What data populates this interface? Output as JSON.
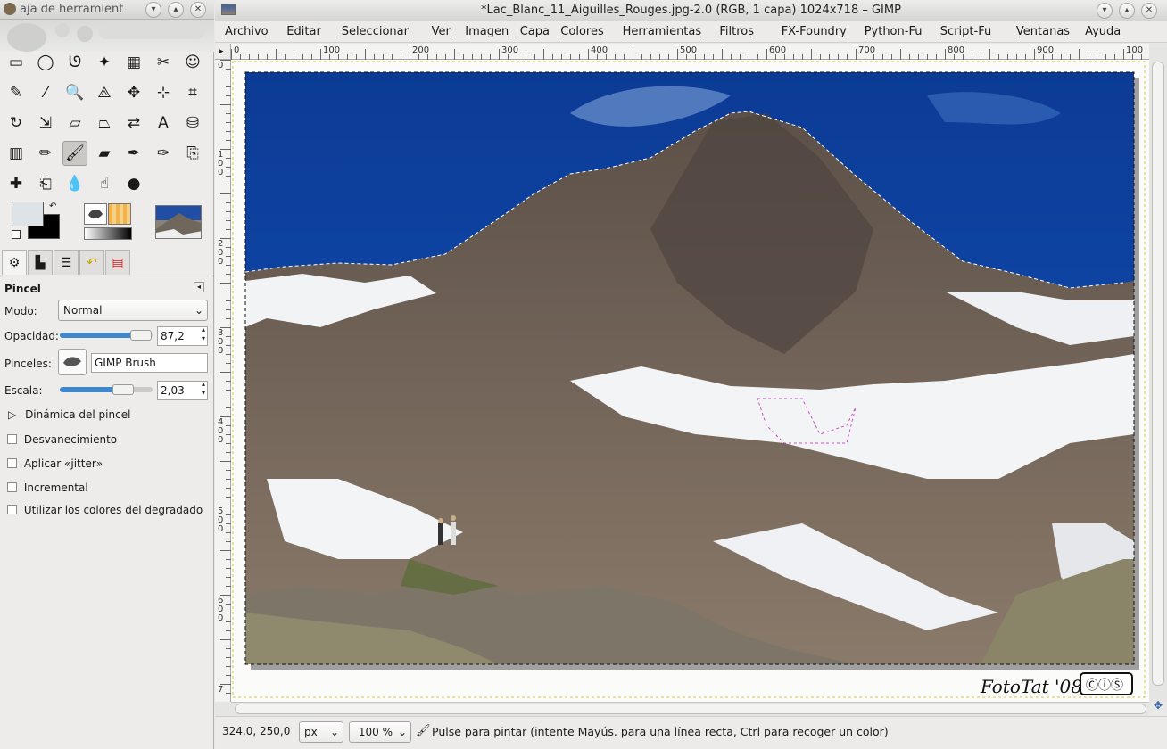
{
  "toolbox": {
    "title": "aja de herramient",
    "tools": [
      {
        "icon": "rect-select-icon",
        "glyph": "▭"
      },
      {
        "icon": "ellipse-select-icon",
        "glyph": "◯"
      },
      {
        "icon": "free-select-icon",
        "glyph": "ᘎ"
      },
      {
        "icon": "fuzzy-select-icon",
        "glyph": "✦"
      },
      {
        "icon": "color-select-icon",
        "glyph": "▦"
      },
      {
        "icon": "scissors-icon",
        "glyph": "✂"
      },
      {
        "icon": "foreground-select-icon",
        "glyph": "☺"
      },
      {
        "icon": "paths-icon",
        "glyph": "✎"
      },
      {
        "icon": "color-picker-icon",
        "glyph": "⁄"
      },
      {
        "icon": "zoom-icon",
        "glyph": "🔍"
      },
      {
        "icon": "measure-icon",
        "glyph": "⟁"
      },
      {
        "icon": "move-icon",
        "glyph": "✥"
      },
      {
        "icon": "align-icon",
        "glyph": "⊹"
      },
      {
        "icon": "crop-icon",
        "glyph": "⌗"
      },
      {
        "icon": "rotate-icon",
        "glyph": "↻"
      },
      {
        "icon": "scale-icon",
        "glyph": "⇲"
      },
      {
        "icon": "shear-icon",
        "glyph": "▱"
      },
      {
        "icon": "perspective-icon",
        "glyph": "⏢"
      },
      {
        "icon": "flip-icon",
        "glyph": "⇄"
      },
      {
        "icon": "text-icon",
        "glyph": "A"
      },
      {
        "icon": "bucket-fill-icon",
        "glyph": "⛁"
      },
      {
        "icon": "blend-icon",
        "glyph": "▥"
      },
      {
        "icon": "pencil-icon",
        "glyph": "✏"
      },
      {
        "icon": "paintbrush-icon",
        "glyph": "🖌"
      },
      {
        "icon": "eraser-icon",
        "glyph": "▰"
      },
      {
        "icon": "airbrush-icon",
        "glyph": "✒"
      },
      {
        "icon": "ink-icon",
        "glyph": "✑"
      },
      {
        "icon": "clone-icon",
        "glyph": "⎘"
      },
      {
        "icon": "heal-icon",
        "glyph": "✚"
      },
      {
        "icon": "perspective-clone-icon",
        "glyph": "⎗"
      },
      {
        "icon": "blur-icon",
        "glyph": "💧"
      },
      {
        "icon": "smudge-icon",
        "glyph": "☝"
      },
      {
        "icon": "dodge-burn-icon",
        "glyph": "●"
      }
    ],
    "fg_color": "#dde3e6",
    "bg_color": "#000000",
    "tabs": [
      "tool-options-tab",
      "device-status-tab",
      "layers-tab",
      "undo-history-tab",
      "palettes-tab"
    ],
    "options": {
      "title": "Pincel",
      "mode_label": "Modo:",
      "mode_value": "Normal",
      "opacity_label": "Opacidad:",
      "opacity_value": "87,2",
      "opacity_fraction": 0.872,
      "brushes_label": "Pinceles:",
      "brush_name": "GIMP Brush",
      "scale_label": "Escala:",
      "scale_value": "2,03",
      "scale_fraction": 0.68,
      "dynamics": "Dinámica del pincel",
      "checkboxes": [
        "Desvanecimiento",
        "Aplicar «jitter»",
        "Incremental",
        "Utilizar los colores del degradado"
      ]
    }
  },
  "image_window": {
    "title": "*Lac_Blanc_11_Aiguilles_Rouges.jpg-2.0 (RGB, 1 capa) 1024x718 – GIMP",
    "menus": [
      "Archivo",
      "Editar",
      "Seleccionar",
      "Ver",
      "Imagen",
      "Capa",
      "Colores",
      "Herramientas",
      "Filtros",
      "FX-Foundry",
      "Python-Fu",
      "Script-Fu",
      "Ventanas",
      "Ayuda"
    ],
    "hruler_ticks": [
      "0",
      "100",
      "200",
      "300",
      "400",
      "500",
      "600",
      "700",
      "800",
      "900",
      "100"
    ],
    "vruler_ticks": [
      "0",
      "100",
      "200",
      "300",
      "400",
      "500",
      "600",
      "7"
    ],
    "watermark": "FotoTat '08",
    "cc_badge": "ⒸⓘⓈ",
    "status": {
      "coords": "324,0, 250,0",
      "unit": "px",
      "zoom": "100 %",
      "message": "Pulse para pintar (intente Mayús. para una línea recta, Ctrl para recoger un color)"
    }
  },
  "colors": {
    "sky": "#0c3f9e",
    "accent": "#3f87c8"
  }
}
